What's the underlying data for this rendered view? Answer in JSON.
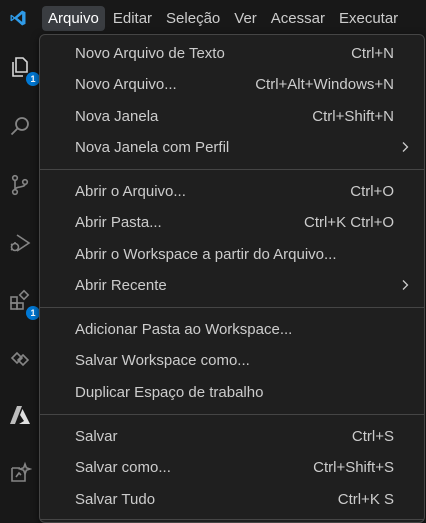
{
  "menubar": {
    "items": [
      {
        "label": "Arquivo"
      },
      {
        "label": "Editar"
      },
      {
        "label": "Seleção"
      },
      {
        "label": "Ver"
      },
      {
        "label": "Acessar"
      },
      {
        "label": "Executar"
      }
    ]
  },
  "activity": {
    "explorer_badge": "1",
    "extensions_badge": "1"
  },
  "menu": {
    "items": [
      {
        "label": "Novo Arquivo de Texto",
        "shortcut": "Ctrl+N"
      },
      {
        "label": "Novo Arquivo...",
        "shortcut": "Ctrl+Alt+Windows+N"
      },
      {
        "label": "Nova Janela",
        "shortcut": "Ctrl+Shift+N"
      },
      {
        "label": "Nova Janela com Perfil",
        "shortcut": ""
      },
      {
        "label": "Abrir o Arquivo...",
        "shortcut": "Ctrl+O"
      },
      {
        "label": "Abrir Pasta...",
        "shortcut": "Ctrl+K Ctrl+O"
      },
      {
        "label": "Abrir o Workspace a partir do Arquivo...",
        "shortcut": ""
      },
      {
        "label": "Abrir Recente",
        "shortcut": ""
      },
      {
        "label": "Adicionar Pasta ao Workspace...",
        "shortcut": ""
      },
      {
        "label": "Salvar Workspace como...",
        "shortcut": ""
      },
      {
        "label": "Duplicar Espaço de trabalho",
        "shortcut": ""
      },
      {
        "label": "Salvar",
        "shortcut": "Ctrl+S"
      },
      {
        "label": "Salvar como...",
        "shortcut": "Ctrl+Shift+S"
      },
      {
        "label": "Salvar Tudo",
        "shortcut": "Ctrl+K S"
      }
    ]
  },
  "colors": {
    "accent": "#0078d4",
    "background": "#181818",
    "menu_background": "#1f1f1f",
    "active_menu": "#3a3d41"
  }
}
